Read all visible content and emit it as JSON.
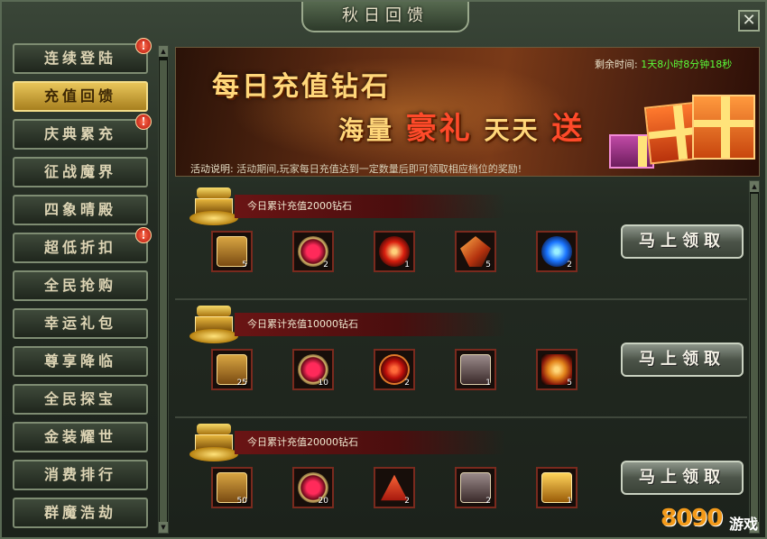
{
  "window": {
    "title": "秋日回馈",
    "close_label": "✕"
  },
  "sidebar": {
    "items": [
      {
        "label": "连续登陆",
        "badge": "!",
        "active": false
      },
      {
        "label": "充值回馈",
        "badge": "",
        "active": true
      },
      {
        "label": "庆典累充",
        "badge": "!",
        "active": false
      },
      {
        "label": "征战魔界",
        "badge": "",
        "active": false
      },
      {
        "label": "四象晴殿",
        "badge": "",
        "active": false
      },
      {
        "label": "超低折扣",
        "badge": "!",
        "active": false
      },
      {
        "label": "全民抢购",
        "badge": "",
        "active": false
      },
      {
        "label": "幸运礼包",
        "badge": "",
        "active": false
      },
      {
        "label": "尊享降临",
        "badge": "",
        "active": false
      },
      {
        "label": "全民探宝",
        "badge": "",
        "active": false
      },
      {
        "label": "金装耀世",
        "badge": "",
        "active": false
      },
      {
        "label": "消费排行",
        "badge": "",
        "active": false
      },
      {
        "label": "群魔浩劫",
        "badge": "",
        "active": false
      }
    ]
  },
  "banner": {
    "line1": "每日充值钻石",
    "line2_a": "海量",
    "line2_hl": "豪礼",
    "line2_b": "天天",
    "line2_c": "送",
    "remaining_label": "剩余时间:",
    "remaining_value": "1天8小时8分钟18秒",
    "desc_label": "活动说明:",
    "desc_text": "活动期间,玩家每日充值达到一定数量后即可领取相应档位的奖励!"
  },
  "tiers": [
    {
      "title": "今日累计充值2000钻石",
      "button": "马上领取",
      "rewards": [
        {
          "icon": "treasure-chest-icon",
          "count": "5"
        },
        {
          "icon": "ruby-ring-icon",
          "count": "2"
        },
        {
          "icon": "fire-orb-icon",
          "count": "1"
        },
        {
          "icon": "wing-crystal-icon",
          "count": "5"
        },
        {
          "icon": "blue-gem-icon",
          "count": "2"
        }
      ]
    },
    {
      "title": "今日累计充值10000钻石",
      "button": "马上领取",
      "rewards": [
        {
          "icon": "treasure-chest-icon",
          "count": "25"
        },
        {
          "icon": "ruby-ring-icon",
          "count": "10"
        },
        {
          "icon": "red-orb-icon",
          "count": "2"
        },
        {
          "icon": "silver-chest-icon",
          "count": "1"
        },
        {
          "icon": "dragon-amulet-icon",
          "count": "5"
        }
      ]
    },
    {
      "title": "今日累计充值20000钻石",
      "button": "马上领取",
      "rewards": [
        {
          "icon": "treasure-chest-icon",
          "count": "50"
        },
        {
          "icon": "ruby-ring-icon",
          "count": "20"
        },
        {
          "icon": "red-triangle-icon",
          "count": "2"
        },
        {
          "icon": "silver-chest-icon",
          "count": "2"
        },
        {
          "icon": "golden-box-icon",
          "count": "1"
        }
      ]
    }
  ],
  "watermark": {
    "num": "8090",
    "text": "游戏"
  }
}
